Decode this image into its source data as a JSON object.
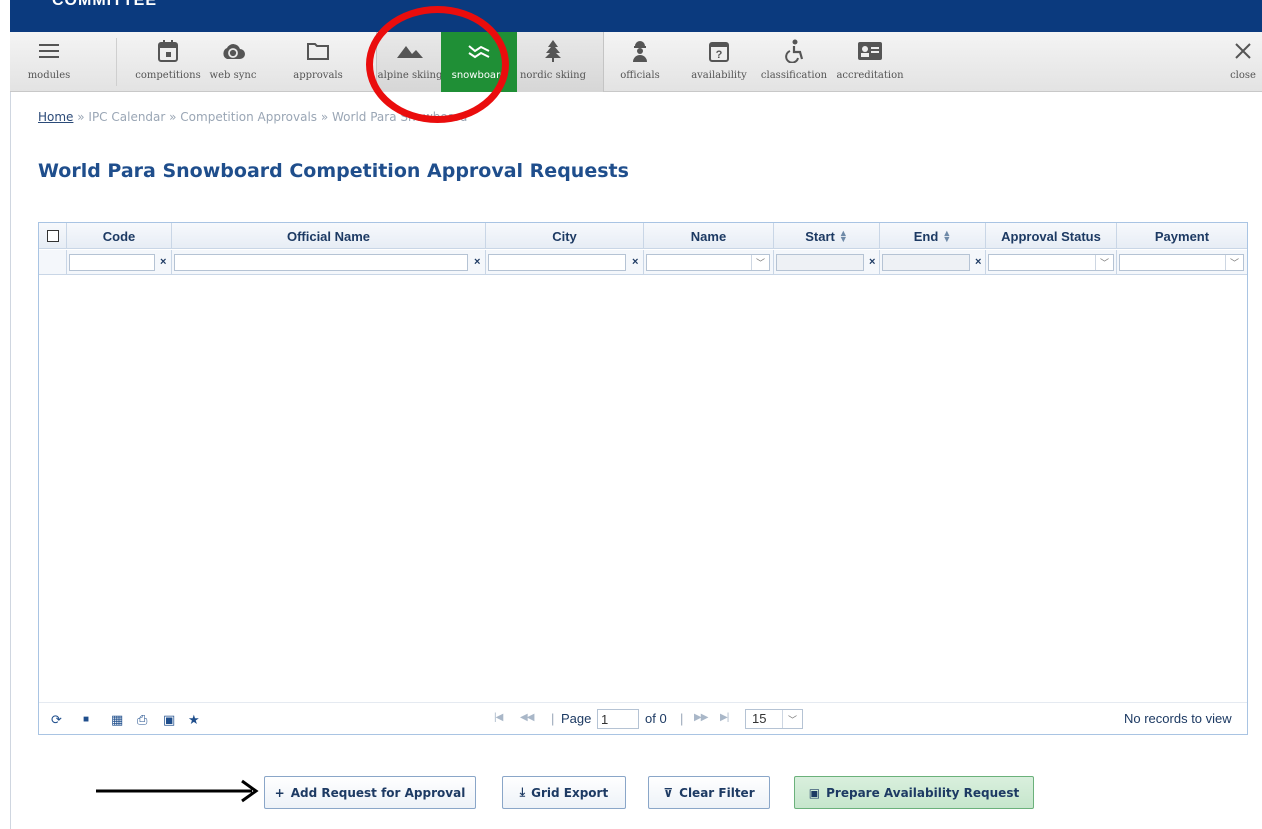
{
  "topbar": {
    "text": "COMMITTEE"
  },
  "toolbar": {
    "items": [
      {
        "label": "modules",
        "icon": "hamburger-icon"
      },
      {
        "label": "competitions",
        "icon": "calendar-icon"
      },
      {
        "label": "web sync",
        "icon": "cloud-sync-icon"
      },
      {
        "label": "approvals",
        "icon": "folder-icon"
      },
      {
        "label": "alpine skiing",
        "icon": "mountain-icon"
      },
      {
        "label": "snowboard",
        "icon": "snowboard-icon",
        "active": true
      },
      {
        "label": "nordic skiing",
        "icon": "tree-icon"
      },
      {
        "label": "officials",
        "icon": "official-icon"
      },
      {
        "label": "availability",
        "icon": "calendar-question-icon"
      },
      {
        "label": "classification",
        "icon": "accessibility-icon"
      },
      {
        "label": "accreditation",
        "icon": "id-card-icon"
      },
      {
        "label": "close",
        "icon": "close-icon"
      }
    ]
  },
  "breadcrumb": {
    "home": "Home",
    "rest": " » IPC Calendar » Competition Approvals » World Para Snowboard"
  },
  "page": {
    "title": "World Para Snowboard Competition Approval Requests"
  },
  "grid": {
    "columns": [
      "Code",
      "Official Name",
      "City",
      "Name",
      "Start",
      "End",
      "Approval Status",
      "Payment"
    ],
    "pager": {
      "page_label": "Page",
      "page_value": "1",
      "of_label": "of 0",
      "page_size": "15",
      "empty_text": "No records to view"
    }
  },
  "buttons": {
    "add": "Add Request for Approval",
    "export": "Grid Export",
    "clear": "Clear Filter",
    "prepare": "Prepare Availability Request"
  },
  "colors": {
    "banner": "#0b3a7e",
    "active_tab": "#1f8f36",
    "annotation": "#ea0d0d",
    "title": "#1f4e8c"
  }
}
